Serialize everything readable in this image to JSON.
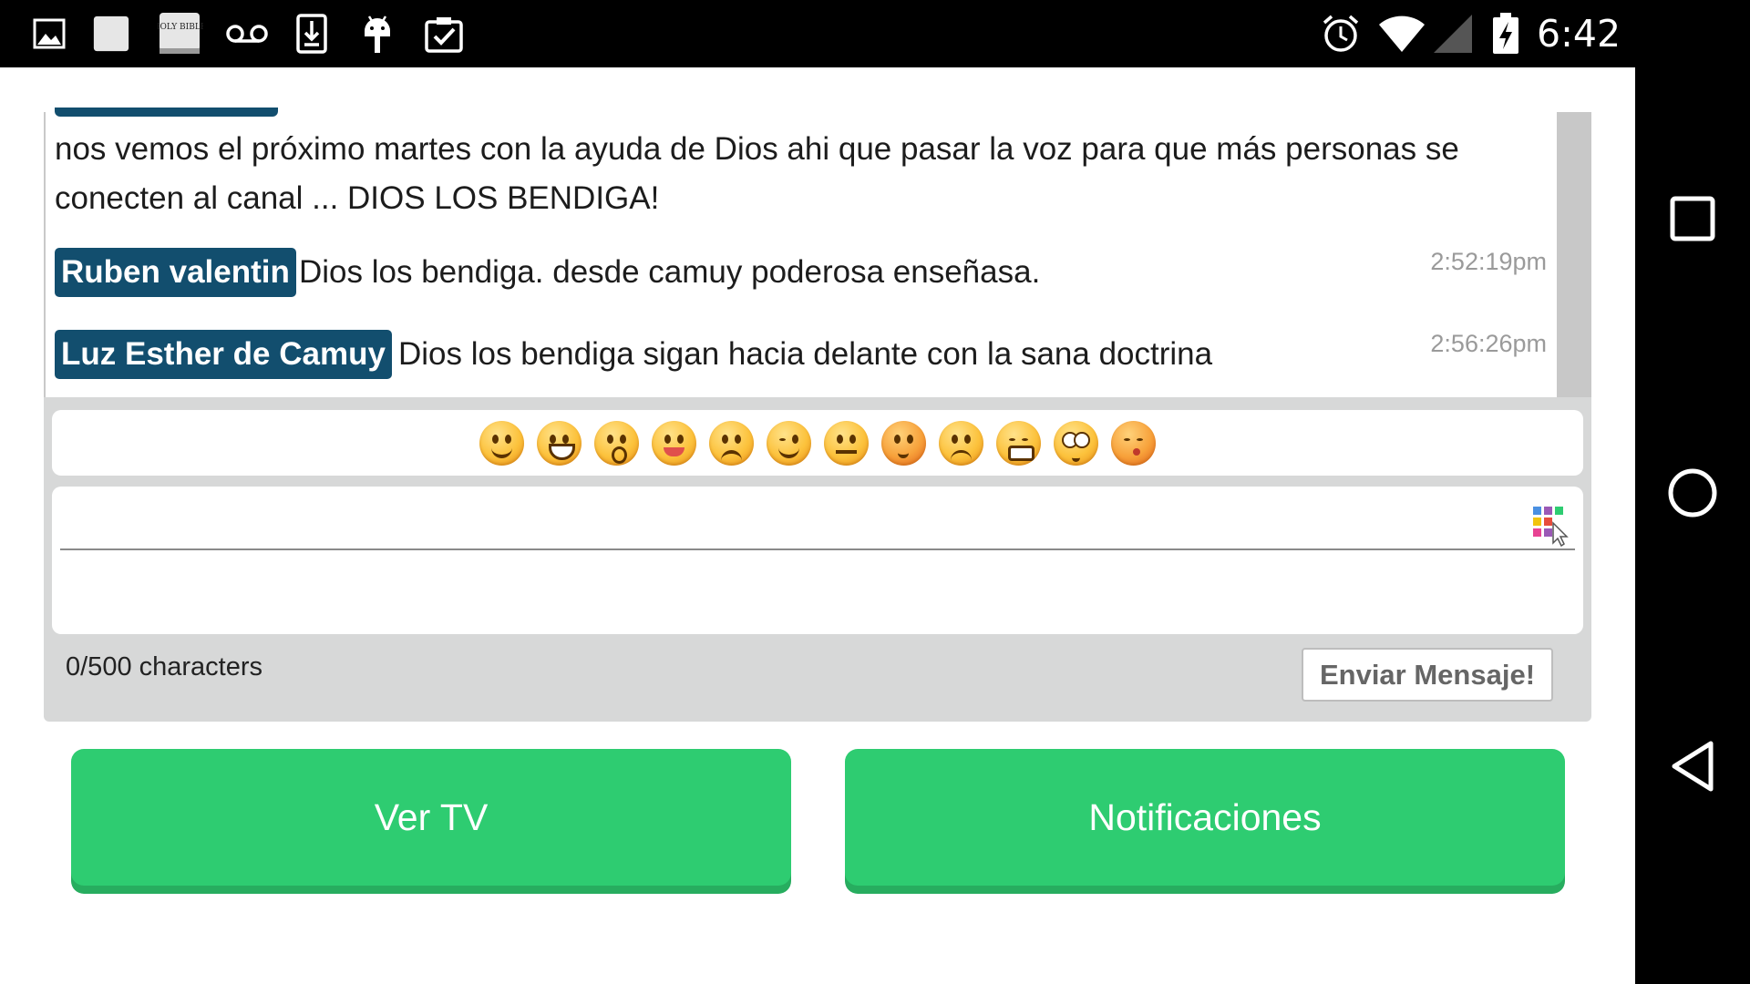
{
  "status_bar": {
    "time": "6:42",
    "left_icons": [
      "image-icon",
      "blank-square-icon",
      "holy-bible-icon",
      "voicemail-icon",
      "download-icon",
      "android-icon",
      "clipboard-check-icon"
    ],
    "right_icons": [
      "alarm-icon",
      "wifi-icon",
      "cell-signal-icon",
      "battery-charging-icon"
    ],
    "bible_icon_text": "HOLY BIBLE"
  },
  "chat": {
    "messages": [
      {
        "author": "",
        "text": "nos vemos el próximo martes con la ayuda de Dios ahi que pasar la voz para que más personas se conecten al canal ... DIOS LOS BENDIGA!",
        "time": ""
      },
      {
        "author": "Ruben valentin",
        "text": "Dios los bendiga. desde camuy poderosa enseñasa.",
        "time": "2:52:19pm"
      },
      {
        "author": "Luz Esther de Camuy",
        "text": "Dios los bendiga sigan hacia delante con la sana doctrina",
        "time": "2:56:26pm"
      }
    ]
  },
  "composer": {
    "emojis": [
      "smile-emoji-icon",
      "grin-emoji-icon",
      "surprised-emoji-icon",
      "tongue-emoji-icon",
      "frown-emoji-icon",
      "wink-emoji-icon",
      "neutral-emoji-icon",
      "blush-emoji-icon",
      "sad-emoji-icon",
      "crying-emoji-icon",
      "dizzy-emoji-icon",
      "kiss-emoji-icon"
    ],
    "input_value": "",
    "char_count": "0/500 characters",
    "send_label": "Enviar Mensaje!"
  },
  "actions": {
    "watch_tv_label": "Ver TV",
    "notifications_label": "Notificaciones"
  },
  "colors": {
    "author_tag": "#124e6e",
    "green_button": "#2ecc71",
    "panel_gray": "#d7d8d8"
  }
}
